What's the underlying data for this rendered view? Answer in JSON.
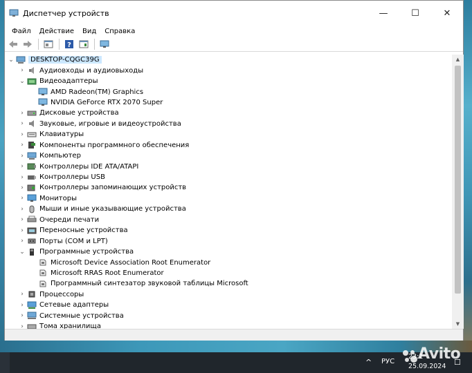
{
  "window": {
    "title": "Диспетчер устройств",
    "controls": {
      "minimize": "—",
      "maximize": "☐",
      "close": "✕"
    }
  },
  "menu": [
    "Файл",
    "Действие",
    "Вид",
    "Справка"
  ],
  "toolbar": {
    "icons": [
      "back-arrow-icon",
      "forward-arrow-icon",
      "properties-icon",
      "help-icon",
      "update-driver-icon",
      "monitor-scan-icon"
    ]
  },
  "tree": {
    "root": "DESKTOP-CQGC39G",
    "categories": [
      {
        "label": "Аудиовходы и аудиовыходы",
        "icon": "audio-io-icon",
        "expanded": false,
        "children": []
      },
      {
        "label": "Видеоадаптеры",
        "icon": "display-adapter-icon",
        "expanded": true,
        "children": [
          "AMD Radeon(TM) Graphics",
          "NVIDIA GeForce RTX 2070 Super"
        ]
      },
      {
        "label": "Дисковые устройства",
        "icon": "disk-drive-icon",
        "expanded": false,
        "children": []
      },
      {
        "label": "Звуковые, игровые и видеоустройства",
        "icon": "sound-icon",
        "expanded": false,
        "children": []
      },
      {
        "label": "Клавиатуры",
        "icon": "keyboard-icon",
        "expanded": false,
        "children": []
      },
      {
        "label": "Компоненты программного обеспечения",
        "icon": "software-component-icon",
        "expanded": false,
        "children": []
      },
      {
        "label": "Компьютер",
        "icon": "computer-icon",
        "expanded": false,
        "children": []
      },
      {
        "label": "Контроллеры IDE ATA/ATAPI",
        "icon": "ide-controller-icon",
        "expanded": false,
        "children": []
      },
      {
        "label": "Контроллеры USB",
        "icon": "usb-icon",
        "expanded": false,
        "children": []
      },
      {
        "label": "Контроллеры запоминающих устройств",
        "icon": "storage-controller-icon",
        "expanded": false,
        "children": []
      },
      {
        "label": "Мониторы",
        "icon": "monitor-icon",
        "expanded": false,
        "children": []
      },
      {
        "label": "Мыши и иные указывающие устройства",
        "icon": "mouse-icon",
        "expanded": false,
        "children": []
      },
      {
        "label": "Очереди печати",
        "icon": "printer-icon",
        "expanded": false,
        "children": []
      },
      {
        "label": "Переносные устройства",
        "icon": "portable-device-icon",
        "expanded": false,
        "children": []
      },
      {
        "label": "Порты (COM и LPT)",
        "icon": "port-icon",
        "expanded": false,
        "children": []
      },
      {
        "label": "Программные устройства",
        "icon": "software-device-icon",
        "expanded": true,
        "children": [
          "Microsoft Device Association Root Enumerator",
          "Microsoft RRAS Root Enumerator",
          "Программный синтезатор звуковой таблицы Microsoft"
        ]
      },
      {
        "label": "Процессоры",
        "icon": "processor-icon",
        "expanded": false,
        "children": []
      },
      {
        "label": "Сетевые адаптеры",
        "icon": "network-adapter-icon",
        "expanded": false,
        "children": []
      },
      {
        "label": "Системные устройства",
        "icon": "system-device-icon",
        "expanded": false,
        "children": []
      },
      {
        "label": "Тома хранилища",
        "icon": "storage-volume-icon",
        "expanded": false,
        "children": []
      }
    ]
  },
  "taskbar": {
    "chevron": "^",
    "language": "РУС",
    "time": "23:1",
    "date": "25.09.2024"
  },
  "watermark": "Avito",
  "colors": {
    "selection": "#cce8ff",
    "taskbar": "#20262c",
    "window_bg": "#ffffff"
  }
}
